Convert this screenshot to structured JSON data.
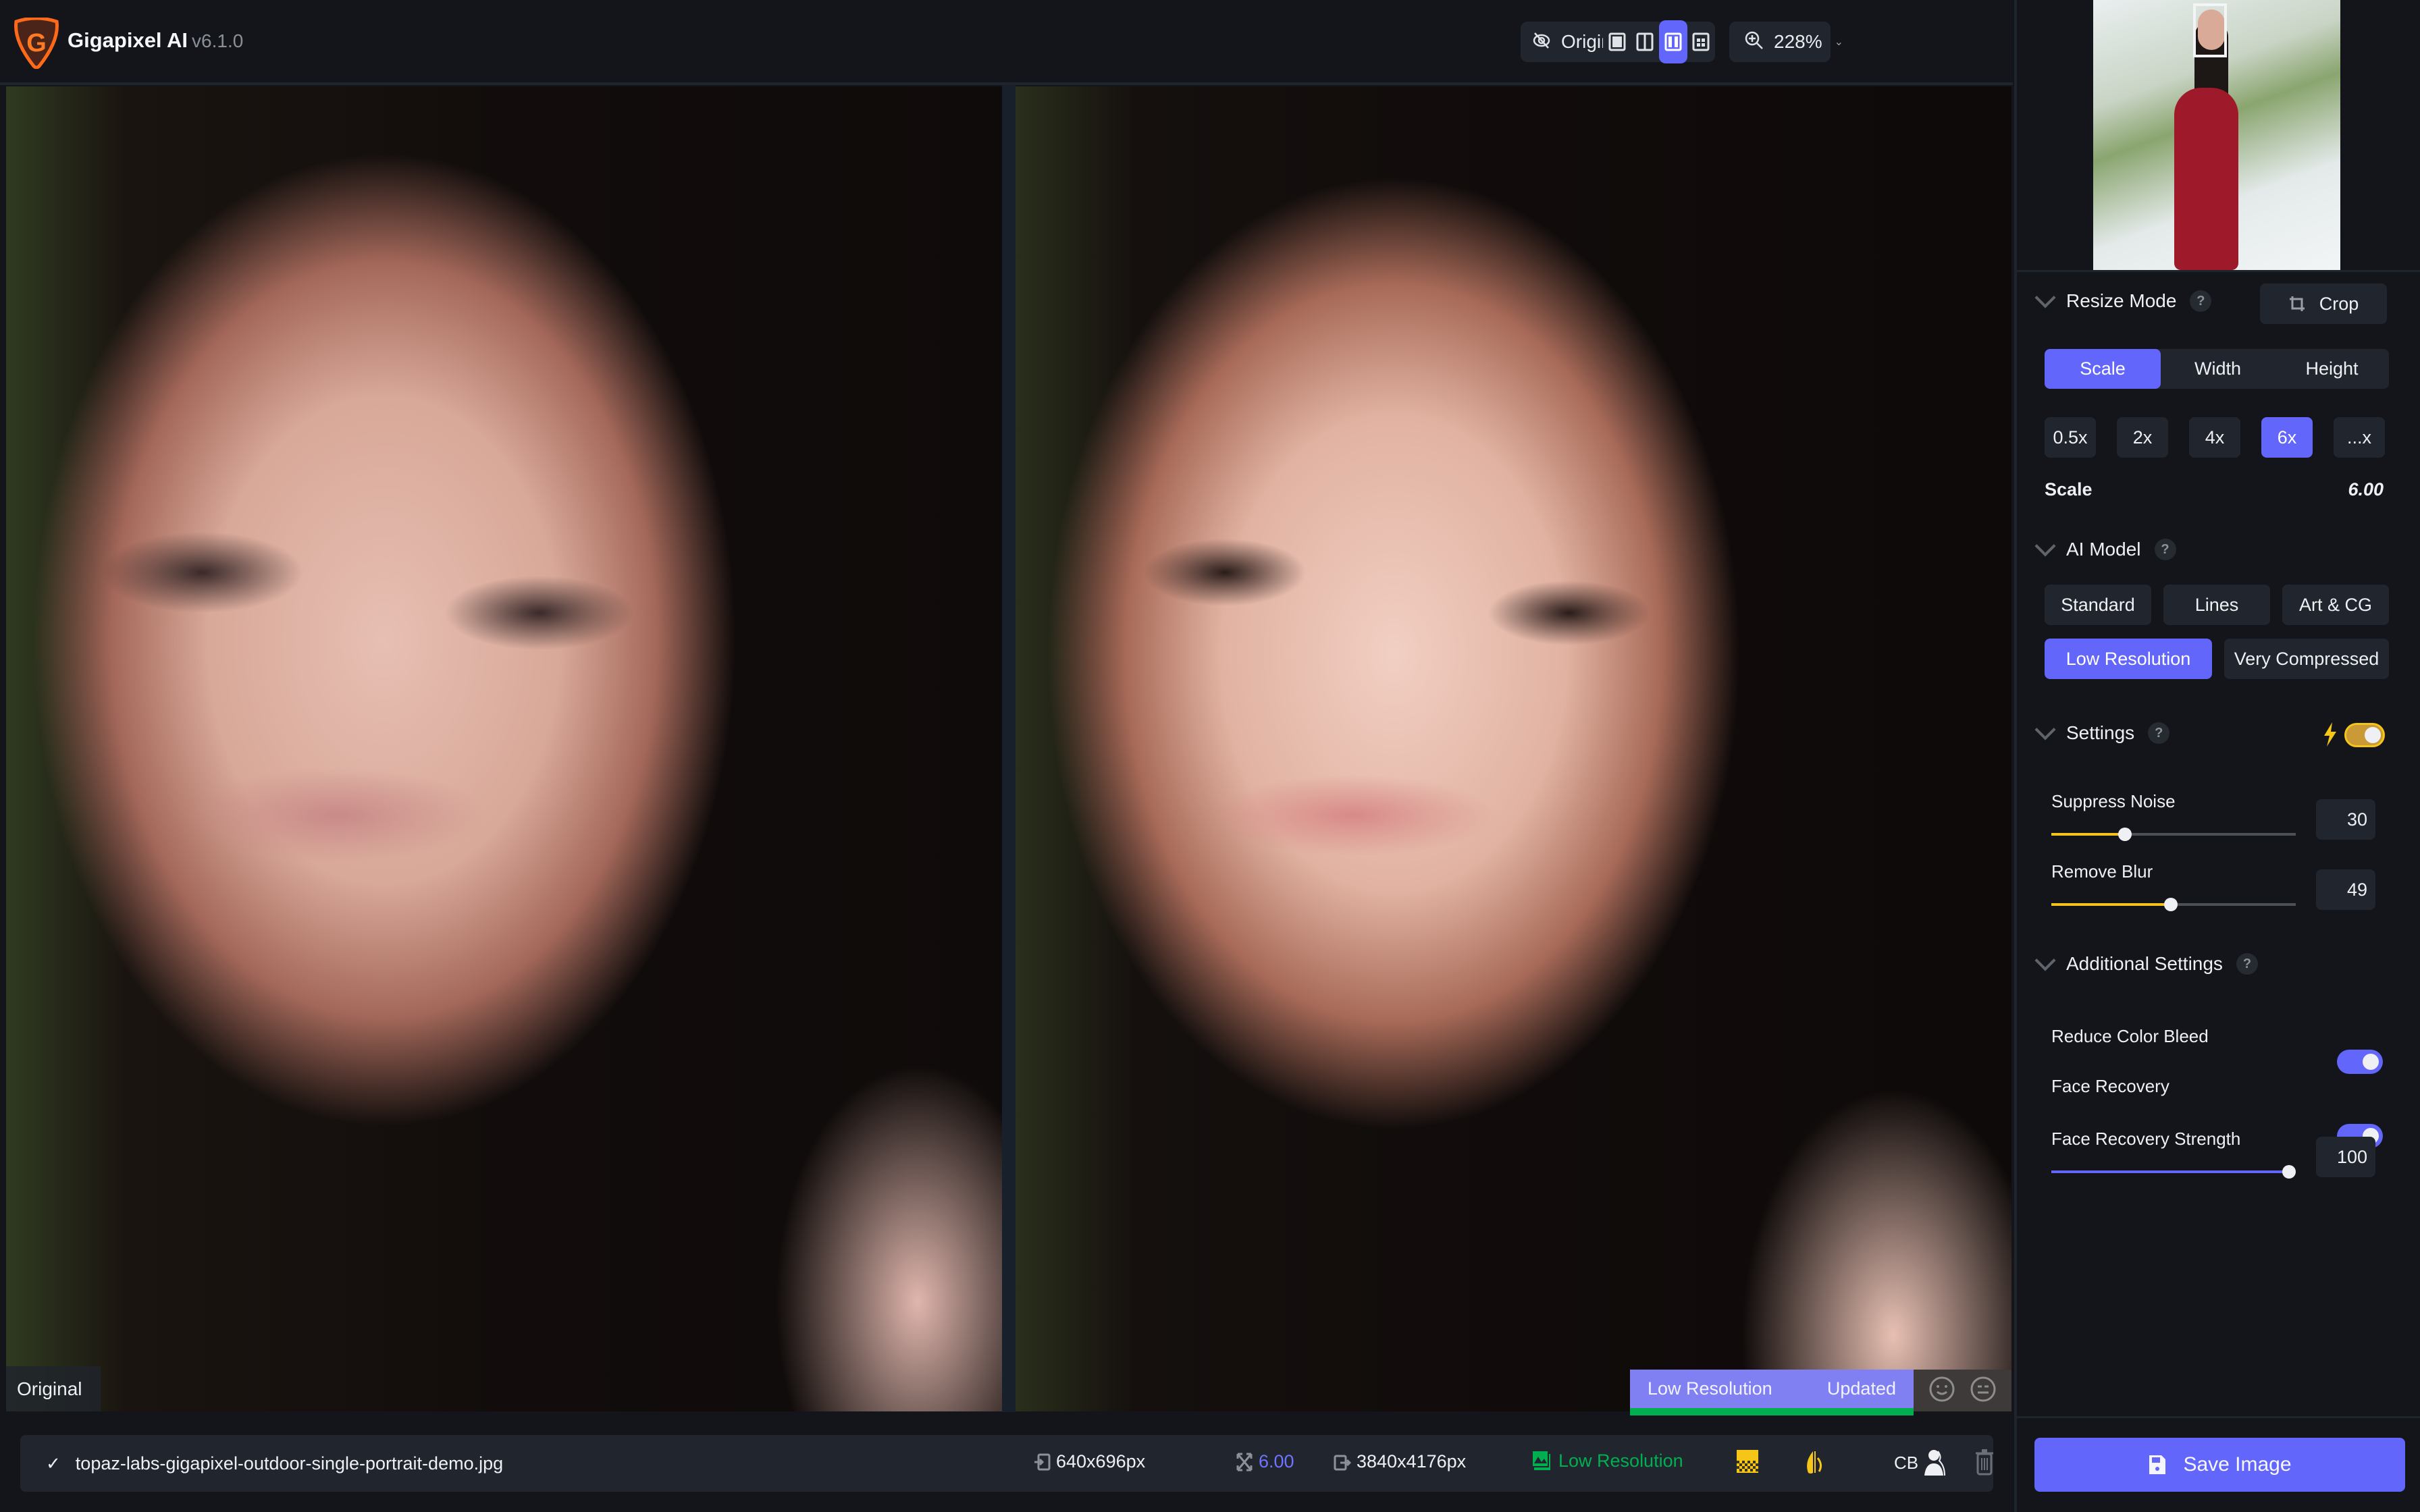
{
  "app": {
    "name": "Gigapixel AI",
    "version": "v6.1.0"
  },
  "toolbar": {
    "original_label": "Original",
    "view_modes": [
      {
        "name": "single-view",
        "active": false
      },
      {
        "name": "split-view",
        "active": false
      },
      {
        "name": "side-by-side-view",
        "active": true
      },
      {
        "name": "grid-view",
        "active": false
      }
    ],
    "zoom_level": "228%"
  },
  "preview": {
    "left_label": "Original",
    "status_model": "Low Resolution",
    "status_state": "Updated",
    "progress_fraction": 1.0
  },
  "panel": {
    "resize_mode": {
      "title": "Resize Mode",
      "help": "?",
      "crop_label": "Crop",
      "tabs": [
        {
          "label": "Scale",
          "active": true
        },
        {
          "label": "Width",
          "active": false
        },
        {
          "label": "Height",
          "active": false
        }
      ],
      "presets": [
        {
          "label": "0.5x",
          "active": false
        },
        {
          "label": "2x",
          "active": false
        },
        {
          "label": "4x",
          "active": false
        },
        {
          "label": "6x",
          "active": true
        },
        {
          "label": "...x",
          "active": false
        }
      ],
      "scale_label": "Scale",
      "scale_value": "6.00"
    },
    "ai_model": {
      "title": "AI Model",
      "help": "?",
      "models": [
        {
          "label": "Standard",
          "active": false
        },
        {
          "label": "Lines",
          "active": false
        },
        {
          "label": "Art & CG",
          "active": false
        },
        {
          "label": "Low Resolution",
          "active": true
        },
        {
          "label": "Very Compressed",
          "active": false
        }
      ]
    },
    "settings": {
      "title": "Settings",
      "help": "?",
      "auto_enabled": true,
      "sliders": [
        {
          "label": "Suppress Noise",
          "value": "30",
          "fraction": 0.3
        },
        {
          "label": "Remove Blur",
          "value": "49",
          "fraction": 0.49
        }
      ]
    },
    "additional": {
      "title": "Additional Settings",
      "help": "?",
      "toggles": [
        {
          "label": "Reduce Color Bleed",
          "on": true
        },
        {
          "label": "Face Recovery",
          "on": true
        }
      ],
      "strength": {
        "label": "Face Recovery Strength",
        "value": "100",
        "fraction": 1.0
      }
    }
  },
  "bottom": {
    "filename": "topaz-labs-gigapixel-outdoor-single-portrait-demo.jpg",
    "input_size": "640x696px",
    "scale": "6.00",
    "output_size": "3840x4176px",
    "model": "Low Resolution",
    "cb_label": "CB",
    "save_label": "Save Image"
  },
  "colors": {
    "accent": "#6366fa",
    "auto_yellow": "#f5c518",
    "success_green": "#00b050",
    "panel_bg": "#13151a",
    "control_bg": "#21262e"
  }
}
